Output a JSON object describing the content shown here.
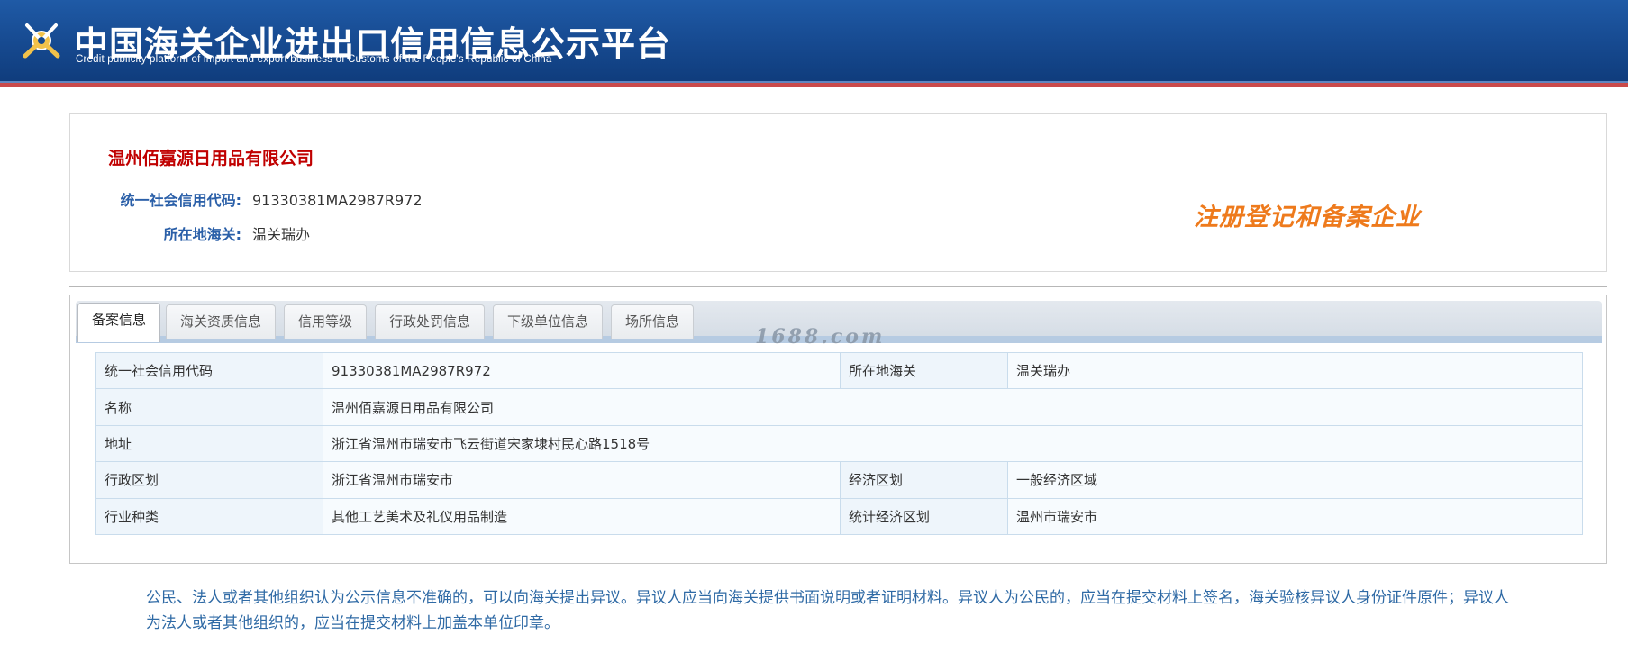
{
  "header": {
    "title": "中国海关企业进出口信用信息公示平台",
    "subtitle": "Credit publicity platform of import and export business of Customs of the People's Republic of China",
    "logo_icon": "customs-emblem-icon"
  },
  "company": {
    "name": "温州佰嘉源日用品有限公司",
    "credit_code_label": "统一社会信用代码:",
    "credit_code": "91330381MA2987R972",
    "customs_label": "所在地海关:",
    "customs": "温关瑞办",
    "stamp": "注册登记和备案企业"
  },
  "tabs": [
    {
      "label": "备案信息",
      "active": true
    },
    {
      "label": "海关资质信息",
      "active": false
    },
    {
      "label": "信用等级",
      "active": false
    },
    {
      "label": "行政处罚信息",
      "active": false
    },
    {
      "label": "下级单位信息",
      "active": false
    },
    {
      "label": "场所信息",
      "active": false
    }
  ],
  "watermark": "1688.com",
  "table": {
    "r1": {
      "l1": "统一社会信用代码",
      "v1": "91330381MA2987R972",
      "l2": "所在地海关",
      "v2": "温关瑞办"
    },
    "r2": {
      "l1": "名称",
      "v1": "温州佰嘉源日用品有限公司"
    },
    "r3": {
      "l1": "地址",
      "v1": "浙江省温州市瑞安市飞云街道宋家埭村民心路1518号"
    },
    "r4": {
      "l1": "行政区划",
      "v1": "浙江省温州市瑞安市",
      "l2": "经济区划",
      "v2": "一般经济区域"
    },
    "r5": {
      "l1": "行业种类",
      "v1": "其他工艺美术及礼仪用品制造",
      "l2": "统计经济区划",
      "v2": "温州市瑞安市"
    }
  },
  "notice": "公民、法人或者其他组织认为公示信息不准确的，可以向海关提出异议。异议人应当向海关提供书面说明或者证明材料。异议人为公民的，应当在提交材料上签名，海关验核异议人身份证件原件；异议人为法人或者其他组织的，应当在提交材料上加盖本单位印章。",
  "colors": {
    "header_blue": "#16498f",
    "company_red": "#c00000",
    "label_blue": "#2a5fa8",
    "stamp_orange": "#ee7a1c",
    "notice_blue": "#2f6aa5"
  }
}
